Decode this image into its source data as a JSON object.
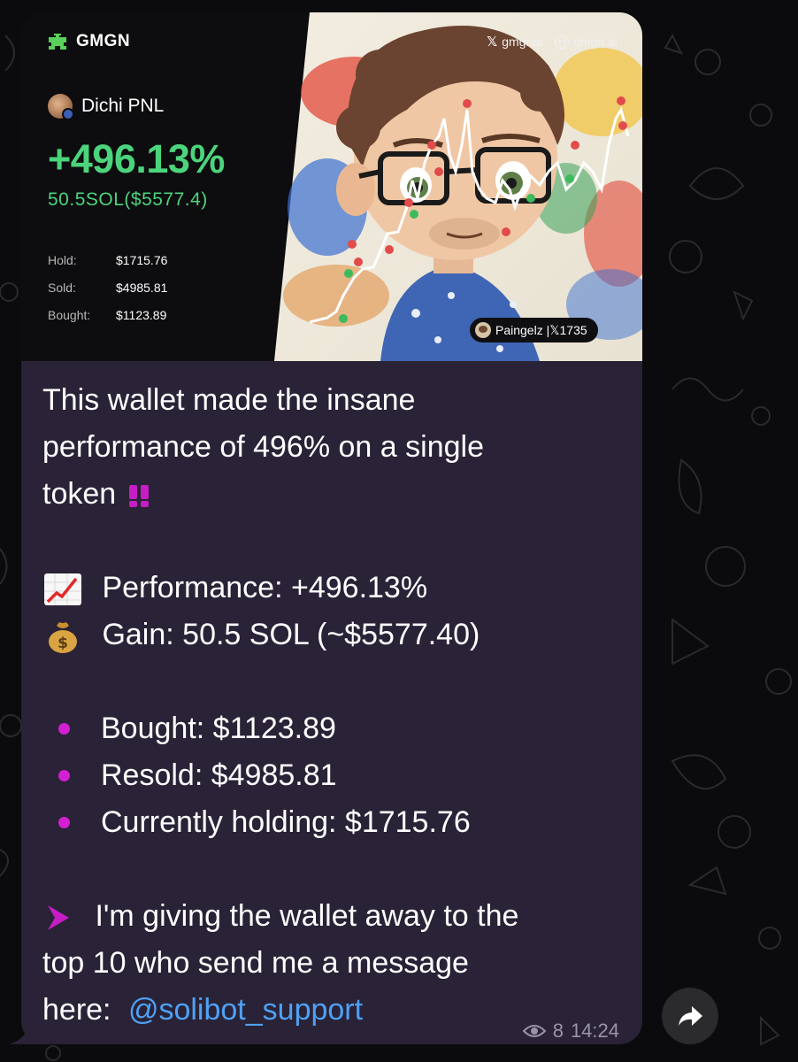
{
  "card": {
    "brand": "GMGN",
    "social_x": "gmgnai",
    "social_web": "gmgn.ai",
    "user_name": "Dichi PNL",
    "pnl_percent": "+496.13%",
    "pnl_sol": "50.5SOL($5577.4)",
    "stats": [
      {
        "label": "Hold:",
        "value": "$1715.76"
      },
      {
        "label": "Sold:",
        "value": "$4985.81"
      },
      {
        "label": "Bought:",
        "value": "$1123.89"
      }
    ],
    "watermark": "Paingelz |𝕏1735",
    "accent_green": "#4cd47c"
  },
  "message": {
    "intro_line1": "This wallet made the insane",
    "intro_line2": "performance of 496% on a single",
    "intro_line3": "token",
    "performance": "Performance: +496.13%",
    "gain": "Gain: 50.5 SOL (~$5577.40)",
    "bullets": [
      "Bought: $1123.89",
      "Resold: $4985.81",
      "Currently holding: $1715.76"
    ],
    "cta_line1": "I'm giving the wallet away to the",
    "cta_line2": "top 10 who send me a message",
    "cta_line3_prefix": "here:",
    "cta_link": "@solibot_support",
    "bullet_color": "#d11fd1",
    "link_color": "#4ea1f5"
  },
  "meta": {
    "views": "8",
    "time": "14:24"
  },
  "icons": {
    "views": "eye-icon",
    "forward": "forward-arrow-icon",
    "chart_emoji": "chart-increasing-icon",
    "money_emoji": "money-bag-icon",
    "exclaim_emoji": "double-exclamation-icon",
    "arrow_emoji": "play-arrow-icon"
  }
}
